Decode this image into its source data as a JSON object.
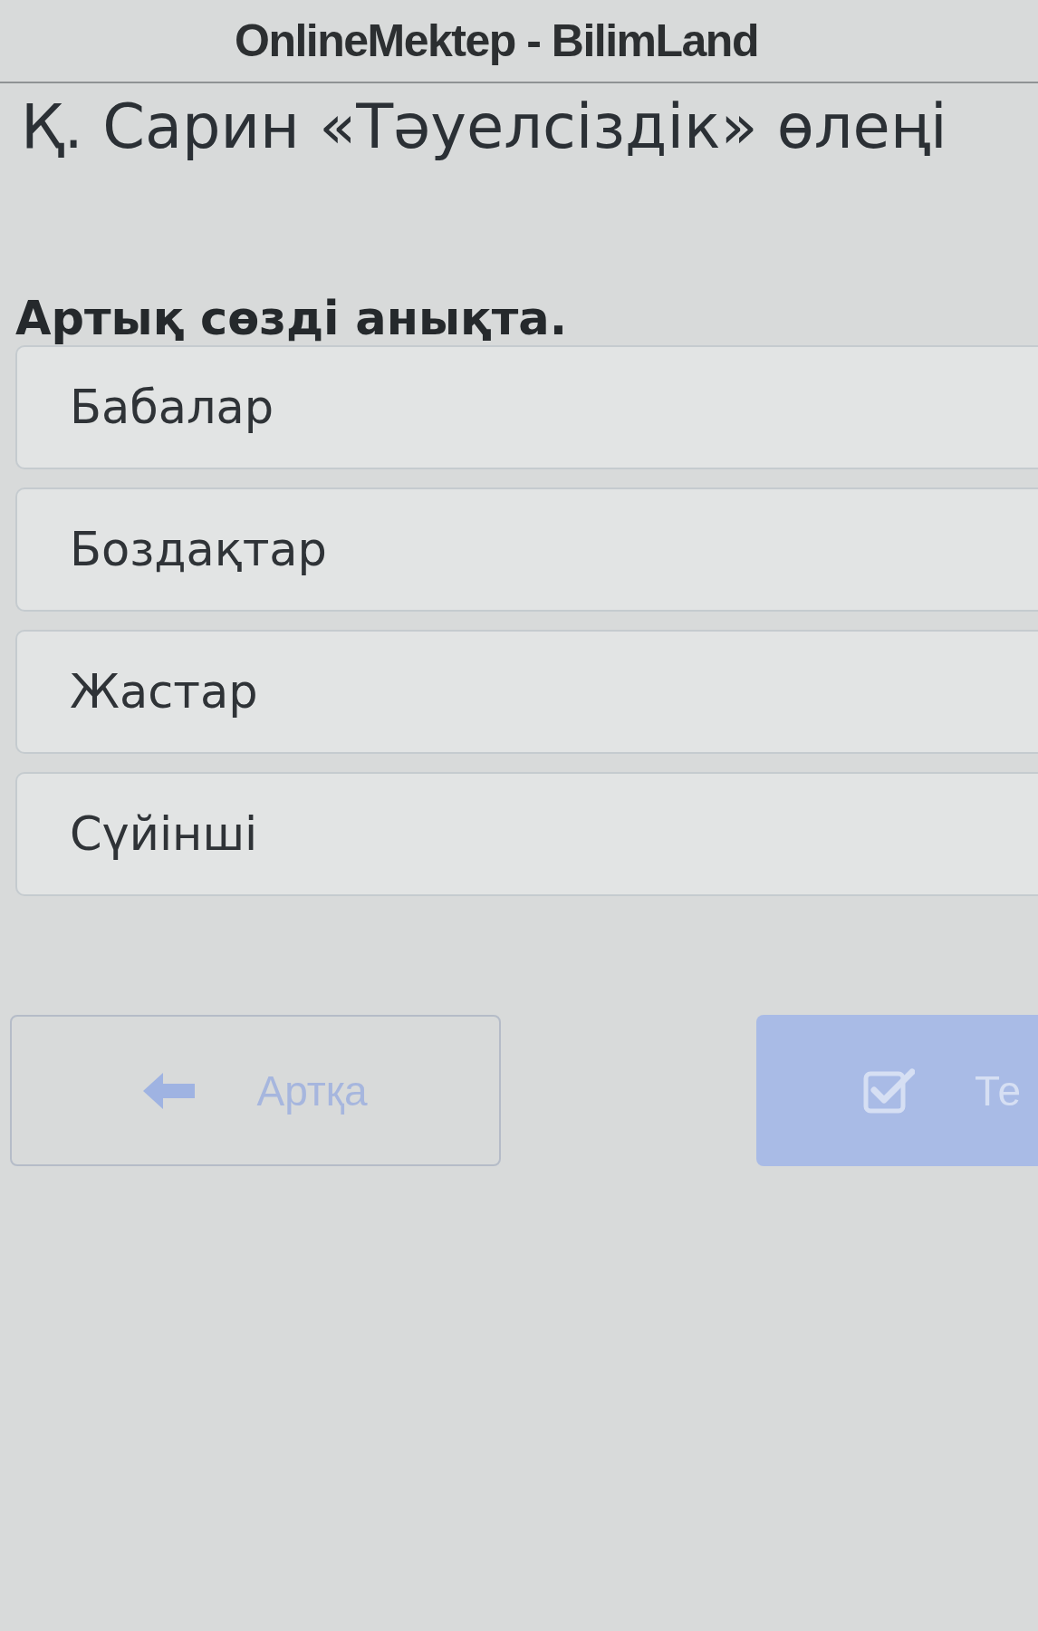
{
  "header": {
    "title": "OnlineMektep - BilimLand"
  },
  "lesson": {
    "title": "Қ. Сарин «Тәуелсіздік» өлеңі"
  },
  "question": {
    "prompt": "Артық сөзді анықта.",
    "options": [
      {
        "label": "Бабалар",
        "selected": false
      },
      {
        "label": "Боздақтар",
        "selected": false
      },
      {
        "label": "Жастар",
        "selected": false
      },
      {
        "label": "Сүйінші",
        "selected": false
      }
    ]
  },
  "buttons": [
    {
      "kind": "back",
      "label": "Артқа",
      "disabled": true
    },
    {
      "kind": "check",
      "label": "Те",
      "disabled": true
    }
  ]
}
